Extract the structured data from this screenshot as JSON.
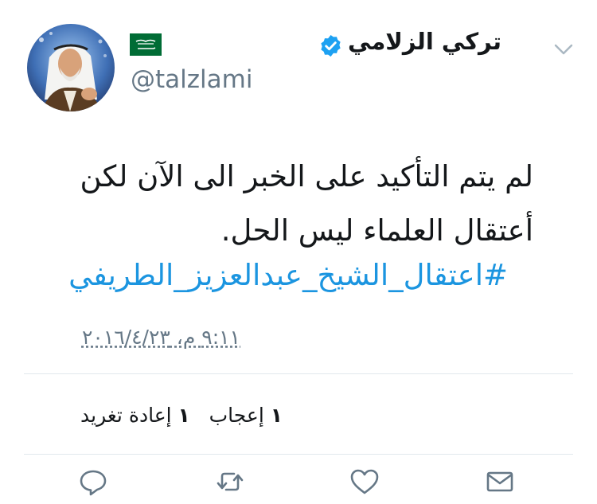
{
  "user": {
    "display_name": "تركي الزلامي",
    "handle": "@talzlami",
    "verified_icon": "verified-badge-icon",
    "flag_icon": "saudi-flag-icon",
    "avatar": "profile-photo"
  },
  "tweet": {
    "text_lines": [
      "لم يتم التأكيد على الخبر الى الآن لكن",
      "أعتقال العلماء ليس الحل."
    ],
    "hashtag": "#اعتقال_الشيخ_عبدالعزيز_الطريفي",
    "timestamp": "٩:١١ م، ٢٠١٦/٤/٢٣"
  },
  "stats": {
    "retweet_count": "١",
    "retweet_label": "إعادة تغريد",
    "like_count": "١",
    "like_label": "إعجاب"
  },
  "actions": [
    "reply-icon",
    "retweet-icon",
    "like-icon",
    "direct-message-icon"
  ],
  "colors": {
    "text": "#14171a",
    "secondary": "#657786",
    "link": "#1b95e0",
    "verified": "#1da1f2",
    "flag": "#006c35",
    "divider": "#e1e8ed"
  }
}
